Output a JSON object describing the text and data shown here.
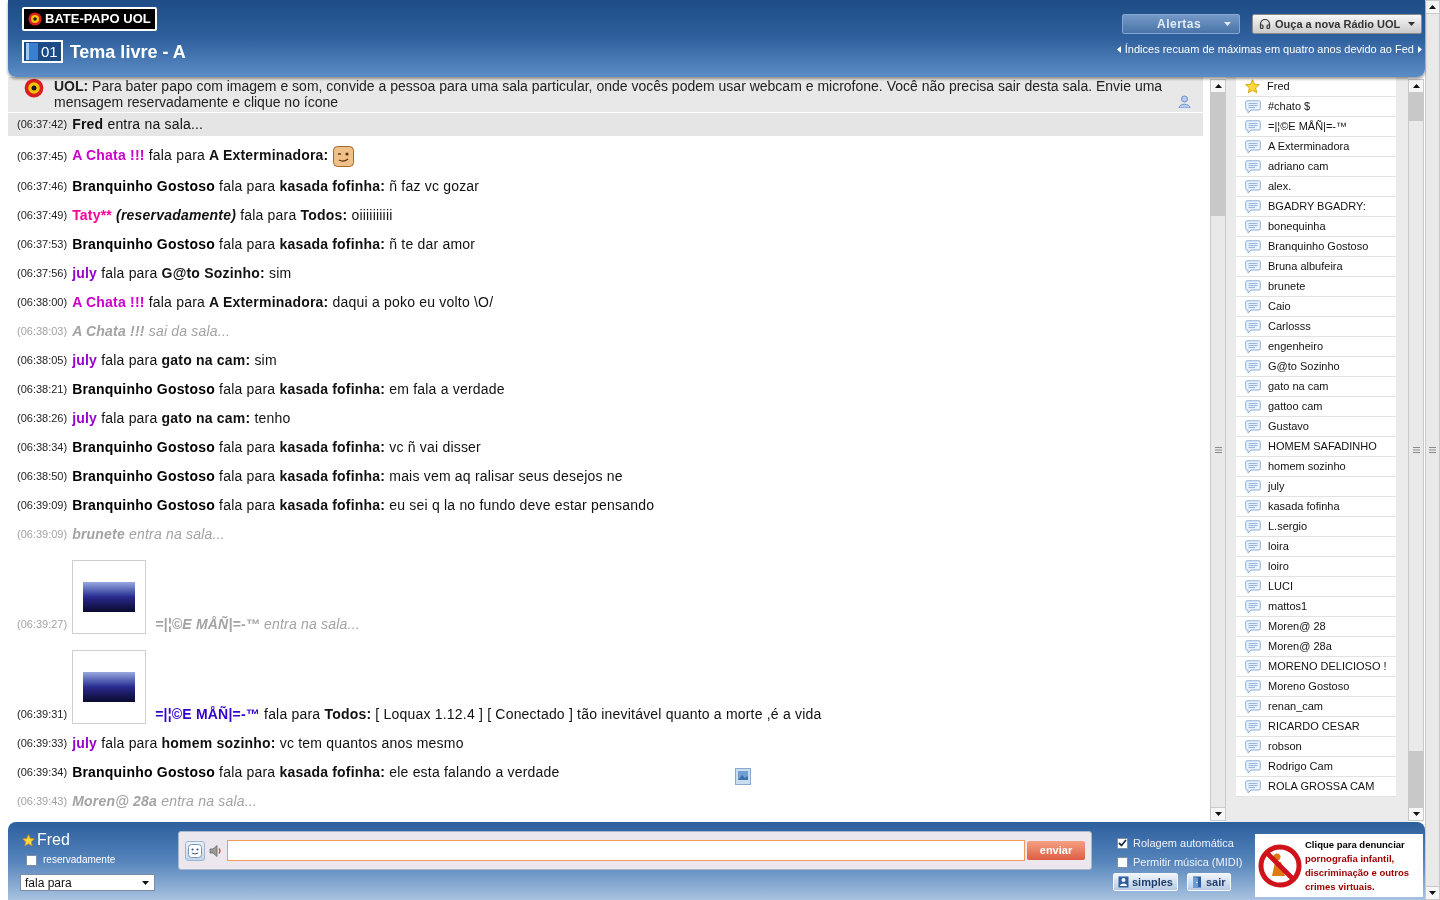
{
  "header": {
    "logo": "BATE-PAPO UOL",
    "room_number": "01",
    "room_name": "Tema livre - A",
    "alerts_button": "Alertas",
    "radio_button": "Ouça a nova Rádio UOL",
    "ticker": "Índices recuam de máximas em quatro anos devido ao Fed"
  },
  "notice": "**UOL:** Para bater papo com imagem e som, convide a pessoa para uma sala particular, onde vocês podem usar webcam e microfone. Você não precisa sair desta sala. Envie uma mensagem reservadamente e clique no ícone",
  "messages": [
    {
      "time": "(06:37:42)",
      "kind": "event",
      "user": "Fred",
      "text": "entra na sala...",
      "muted": false,
      "highlighted": true,
      "avatar": false,
      "emoticon": false
    },
    {
      "time": "(06:37:45)",
      "kind": "message",
      "user": "A Chata !!!",
      "color": "#cc00cc",
      "verb": "fala para",
      "target": "A Exterminadora:",
      "muted": false,
      "highlighted": false,
      "avatar": false,
      "emoticon": true
    },
    {
      "time": "(06:37:46)",
      "kind": "message",
      "user": "Branquinho Gostoso",
      "color": "#000000",
      "verb": "fala para",
      "target": "kasada fofinha:",
      "text": "ñ faz vc gozar",
      "muted": false,
      "highlighted": false,
      "avatar": false,
      "emoticon": false
    },
    {
      "time": "(06:37:49)",
      "kind": "message",
      "user": "Taty**",
      "color": "#ff0099",
      "private_label": "(reservadamente)",
      "verb": "fala para",
      "target": "Todos:",
      "text": "oiiiiiiiiii",
      "muted": false,
      "highlighted": false,
      "avatar": false,
      "emoticon": false
    },
    {
      "time": "(06:37:53)",
      "kind": "message",
      "user": "Branquinho Gostoso",
      "color": "#000000",
      "verb": "fala para",
      "target": "kasada fofinha:",
      "text": "ñ te dar amor",
      "muted": false,
      "highlighted": false,
      "avatar": false,
      "emoticon": false
    },
    {
      "time": "(06:37:56)",
      "kind": "message",
      "user": "july",
      "color": "#9900cc",
      "verb": "fala para",
      "target": "G@to Sozinho:",
      "text": "sim",
      "muted": false,
      "highlighted": false,
      "avatar": false,
      "emoticon": false
    },
    {
      "time": "(06:38:00)",
      "kind": "message",
      "user": "A Chata !!!",
      "color": "#cc00cc",
      "verb": "fala para",
      "target": "A Exterminadora:",
      "text": "daqui a poko eu volto \\O/",
      "muted": false,
      "highlighted": false,
      "avatar": false,
      "emoticon": false
    },
    {
      "time": "(06:38:03)",
      "kind": "event",
      "user": "A Chata !!!",
      "text": "sai da sala...",
      "muted": true,
      "highlighted": false,
      "avatar": false,
      "emoticon": false
    },
    {
      "time": "(06:38:05)",
      "kind": "message",
      "user": "july",
      "color": "#9900cc",
      "verb": "fala para",
      "target": "gato na cam:",
      "text": "sim",
      "muted": false,
      "highlighted": false,
      "avatar": false,
      "emoticon": false
    },
    {
      "time": "(06:38:21)",
      "kind": "message",
      "user": "Branquinho Gostoso",
      "color": "#000000",
      "verb": "fala para",
      "target": "kasada fofinha:",
      "text": "em fala a verdade",
      "muted": false,
      "highlighted": false,
      "avatar": false,
      "emoticon": false
    },
    {
      "time": "(06:38:26)",
      "kind": "message",
      "user": "july",
      "color": "#9900cc",
      "verb": "fala para",
      "target": "gato na cam:",
      "text": "tenho",
      "muted": false,
      "highlighted": false,
      "avatar": false,
      "emoticon": false
    },
    {
      "time": "(06:38:34)",
      "kind": "message",
      "user": "Branquinho Gostoso",
      "color": "#000000",
      "verb": "fala para",
      "target": "kasada fofinha:",
      "text": "vc ñ vai disser",
      "muted": false,
      "highlighted": false,
      "avatar": false,
      "emoticon": false
    },
    {
      "time": "(06:38:50)",
      "kind": "message",
      "user": "Branquinho Gostoso",
      "color": "#000000",
      "verb": "fala para",
      "target": "kasada fofinha:",
      "text": "mais vem aq ralisar seus desejos ne",
      "muted": false,
      "highlighted": false,
      "avatar": false,
      "emoticon": false
    },
    {
      "time": "(06:39:09)",
      "kind": "message",
      "user": "Branquinho Gostoso",
      "color": "#000000",
      "verb": "fala para",
      "target": "kasada fofinha:",
      "text": "eu sei q la no fundo deve estar pensando",
      "muted": false,
      "highlighted": false,
      "avatar": false,
      "emoticon": false
    },
    {
      "time": "(06:39:09)",
      "kind": "event",
      "user": "brunete",
      "text": "entra na sala...",
      "muted": true,
      "highlighted": false,
      "avatar": false,
      "emoticon": false
    },
    {
      "time": "(06:39:27)",
      "kind": "event",
      "user": "=|¦©E MÅÑ|=-™",
      "text": "entra na sala...",
      "muted": true,
      "highlighted": false,
      "avatar": true,
      "emoticon": false
    },
    {
      "time": "(06:39:31)",
      "kind": "message",
      "user": "=|¦©E MÅÑ|=-™",
      "color": "#3300cc",
      "verb": "fala para",
      "target": "Todos:",
      "text": "[ Loquax 1.12.4 ] [ Conectado ] tão inevitável quanto a morte ,é a vida",
      "muted": false,
      "highlighted": false,
      "avatar": true,
      "emoticon": false
    },
    {
      "time": "(06:39:33)",
      "kind": "message",
      "user": "july",
      "color": "#9900cc",
      "verb": "fala para",
      "target": "homem sozinho:",
      "text": "vc tem quantos anos mesmo",
      "muted": false,
      "highlighted": false,
      "avatar": false,
      "emoticon": false
    },
    {
      "time": "(06:39:34)",
      "kind": "message",
      "user": "Branquinho Gostoso",
      "color": "#000000",
      "verb": "fala para",
      "target": "kasada fofinha:",
      "text": "ele esta falando a verdade",
      "muted": false,
      "highlighted": false,
      "avatar": false,
      "emoticon": false
    },
    {
      "time": "(06:39:43)",
      "kind": "event",
      "user": "Moren@ 28a",
      "text": "entra na sala...",
      "muted": true,
      "highlighted": false,
      "avatar": false,
      "emoticon": false
    }
  ],
  "users": [
    {
      "name": "Fred",
      "kind": "self"
    },
    {
      "name": "#chato $",
      "kind": "user"
    },
    {
      "name": "=|¦©E MÅÑ|=-™",
      "kind": "user"
    },
    {
      "name": "A Exterminadora",
      "kind": "user"
    },
    {
      "name": "adriano cam",
      "kind": "user"
    },
    {
      "name": "alex.",
      "kind": "user"
    },
    {
      "name": "BGADRY BGADRY:",
      "kind": "user"
    },
    {
      "name": "bonequinha",
      "kind": "user"
    },
    {
      "name": "Branquinho Gostoso",
      "kind": "user"
    },
    {
      "name": "Bruna albufeira",
      "kind": "user"
    },
    {
      "name": "brunete",
      "kind": "user"
    },
    {
      "name": "Caio",
      "kind": "user"
    },
    {
      "name": "Carlosss",
      "kind": "user"
    },
    {
      "name": "engenheiro",
      "kind": "user"
    },
    {
      "name": "G@to Sozinho",
      "kind": "user"
    },
    {
      "name": "gato na cam",
      "kind": "user"
    },
    {
      "name": "gattoo cam",
      "kind": "user"
    },
    {
      "name": "Gustavo",
      "kind": "user"
    },
    {
      "name": "HOMEM SAFADINHO",
      "kind": "user"
    },
    {
      "name": "homem sozinho",
      "kind": "user"
    },
    {
      "name": "july",
      "kind": "user"
    },
    {
      "name": "kasada fofinha",
      "kind": "user"
    },
    {
      "name": "L.sergio",
      "kind": "user"
    },
    {
      "name": "loira",
      "kind": "user"
    },
    {
      "name": "loiro",
      "kind": "user"
    },
    {
      "name": "LUCI",
      "kind": "user"
    },
    {
      "name": "mattos1",
      "kind": "user"
    },
    {
      "name": "Moren@ 28",
      "kind": "user"
    },
    {
      "name": "Moren@ 28a",
      "kind": "user"
    },
    {
      "name": "MORENO DELICIOSO !",
      "kind": "user"
    },
    {
      "name": "Moreno Gostoso",
      "kind": "user"
    },
    {
      "name": "renan_cam",
      "kind": "user"
    },
    {
      "name": "RICARDO CESAR",
      "kind": "user"
    },
    {
      "name": "robson",
      "kind": "user"
    },
    {
      "name": "Rodrigo Cam",
      "kind": "user"
    },
    {
      "name": "ROLA GROSSA CAM",
      "kind": "user"
    }
  ],
  "compose": {
    "user": "Fred",
    "private_label": "reservadamente",
    "private": false,
    "mode": "fala para",
    "send_button": "enviar"
  },
  "options": [
    {
      "label": "Rolagem automática",
      "checked": true
    },
    {
      "label": "Permitir música (MIDI)",
      "checked": false
    }
  ],
  "buttons": [
    {
      "label": "simples",
      "kind": "simple"
    },
    {
      "label": "sair",
      "kind": "exit"
    }
  ],
  "report_banner": {
    "title": "Clique para denunciar",
    "text": "pornografia infantil, discriminação e outros crimes virtuais."
  }
}
